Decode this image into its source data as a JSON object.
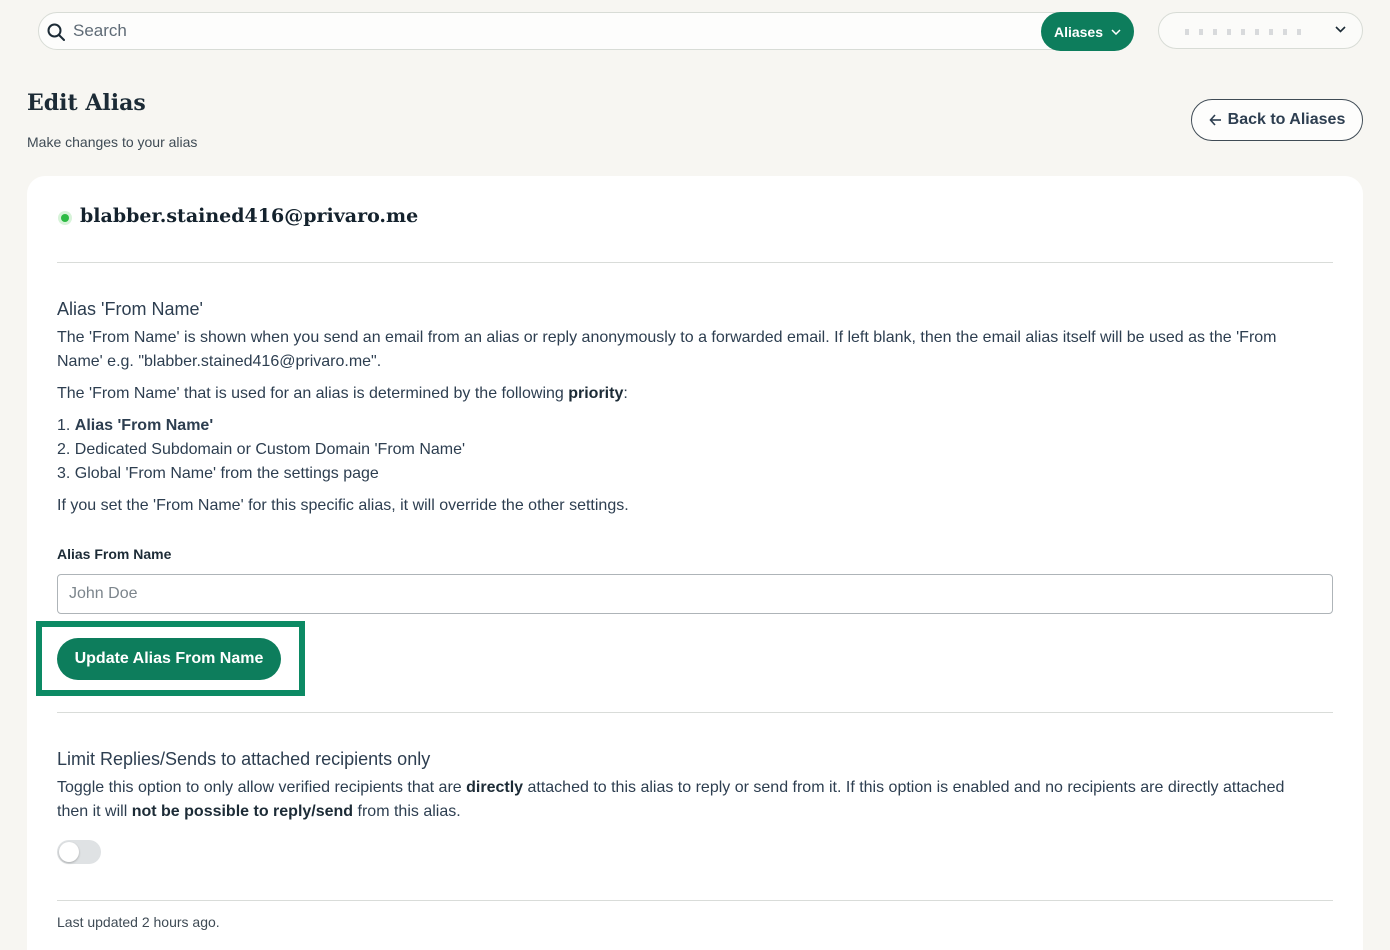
{
  "header": {
    "search_placeholder": "Search",
    "aliases_dropdown_label": "Aliases"
  },
  "page": {
    "title": "Edit Alias",
    "subtitle": "Make changes to your alias",
    "back_button_label": "Back to Aliases"
  },
  "alias": {
    "email": "blabber.stained416@privaro.me",
    "status": "active"
  },
  "from_name_section": {
    "title": "Alias 'From Name'",
    "description": "The 'From Name' is shown when you send an email from an alias or reply anonymously to a forwarded email. If left blank, then the email alias itself will be used as the 'From Name' e.g. \"blabber.stained416@privaro.me\".",
    "priority_intro": "The 'From Name' that is used for an alias is determined by the following ",
    "priority_word": "priority",
    "priority_colon": ":",
    "priority_list": [
      {
        "num": "1. ",
        "text": "Alias 'From Name'"
      },
      {
        "num": "2. ",
        "text": "Dedicated Subdomain or Custom Domain 'From Name'"
      },
      {
        "num": "3. ",
        "text": "Global 'From Name' from the settings page"
      }
    ],
    "override_note": "If you set the 'From Name' for this specific alias, it will override the other settings.",
    "field_label": "Alias From Name",
    "field_placeholder": "John Doe",
    "field_value": "",
    "update_button_label": "Update Alias From Name"
  },
  "limit_section": {
    "title": "Limit Replies/Sends to attached recipients only",
    "desc_part1": "Toggle this option to only allow verified recipients that are ",
    "desc_bold1": "directly",
    "desc_part2": " attached to this alias to reply or send from it. If this option is enabled and no recipients are directly attached then it will ",
    "desc_bold2": "not be possible to reply/send",
    "desc_part3": " from this alias.",
    "toggle_enabled": false
  },
  "footer": {
    "last_updated": "Last updated 2 hours ago."
  },
  "colors": {
    "accent": "#0d7d5c",
    "background": "#f7f6f2",
    "status_active": "#2dbb44"
  }
}
